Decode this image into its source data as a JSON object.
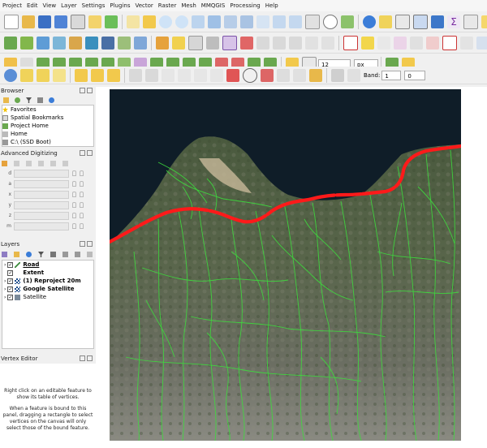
{
  "menubar": {
    "items": [
      "Project",
      "Edit",
      "View",
      "Layer",
      "Settings",
      "Plugins",
      "Vector",
      "Raster",
      "Mesh",
      "MMQGIS",
      "Processing",
      "Help"
    ]
  },
  "digitize_toolbar": {
    "font_size_value": "12",
    "font_unit_value": "px"
  },
  "raster_toolbar": {
    "band_label": "Band:",
    "band_value": "1",
    "band_max_value": "0"
  },
  "browser_panel": {
    "title": "Browser",
    "items": [
      {
        "label": "Favorites",
        "icon": "star-icon"
      },
      {
        "label": "Spatial Bookmarks",
        "icon": "bookmark-icon"
      },
      {
        "label": "Project Home",
        "icon": "project-home-icon"
      },
      {
        "label": "Home",
        "icon": "home-icon"
      },
      {
        "label": "C:\\ (SSD Boot)",
        "icon": "drive-icon"
      }
    ]
  },
  "advanced_digitizing_panel": {
    "title": "Advanced Digitizing",
    "fields": [
      "d",
      "a",
      "x",
      "y",
      "z",
      "m"
    ]
  },
  "layers_panel": {
    "title": "Layers",
    "layers": [
      {
        "label": "Road",
        "checked": true,
        "bold": true,
        "underline": true,
        "icon": "line-layer-icon"
      },
      {
        "label": "Extent",
        "checked": true,
        "bold": true,
        "icon": "polygon-layer-icon"
      },
      {
        "label": "(1) Reproject 20m",
        "checked": true,
        "bold": true,
        "icon": "raster-layer-icon"
      },
      {
        "label": "Google Satellite",
        "checked": true,
        "bold": true,
        "icon": "raster-layer-icon"
      },
      {
        "label": "Satellite",
        "checked": true,
        "bold": false,
        "icon": "satellite-layer-icon"
      }
    ]
  },
  "vertex_editor_panel": {
    "title": "Vertex Editor",
    "message1": "Right click on an editable feature to show its table of vertices.",
    "message2": "When a feature is bound to this panel, dragging a rectangle to select vertices on the canvas will only select those of the bound feature."
  },
  "colors": {
    "road": "#ff1a1a",
    "trails": "#3ddc3d",
    "sea": "#0d1a24"
  }
}
